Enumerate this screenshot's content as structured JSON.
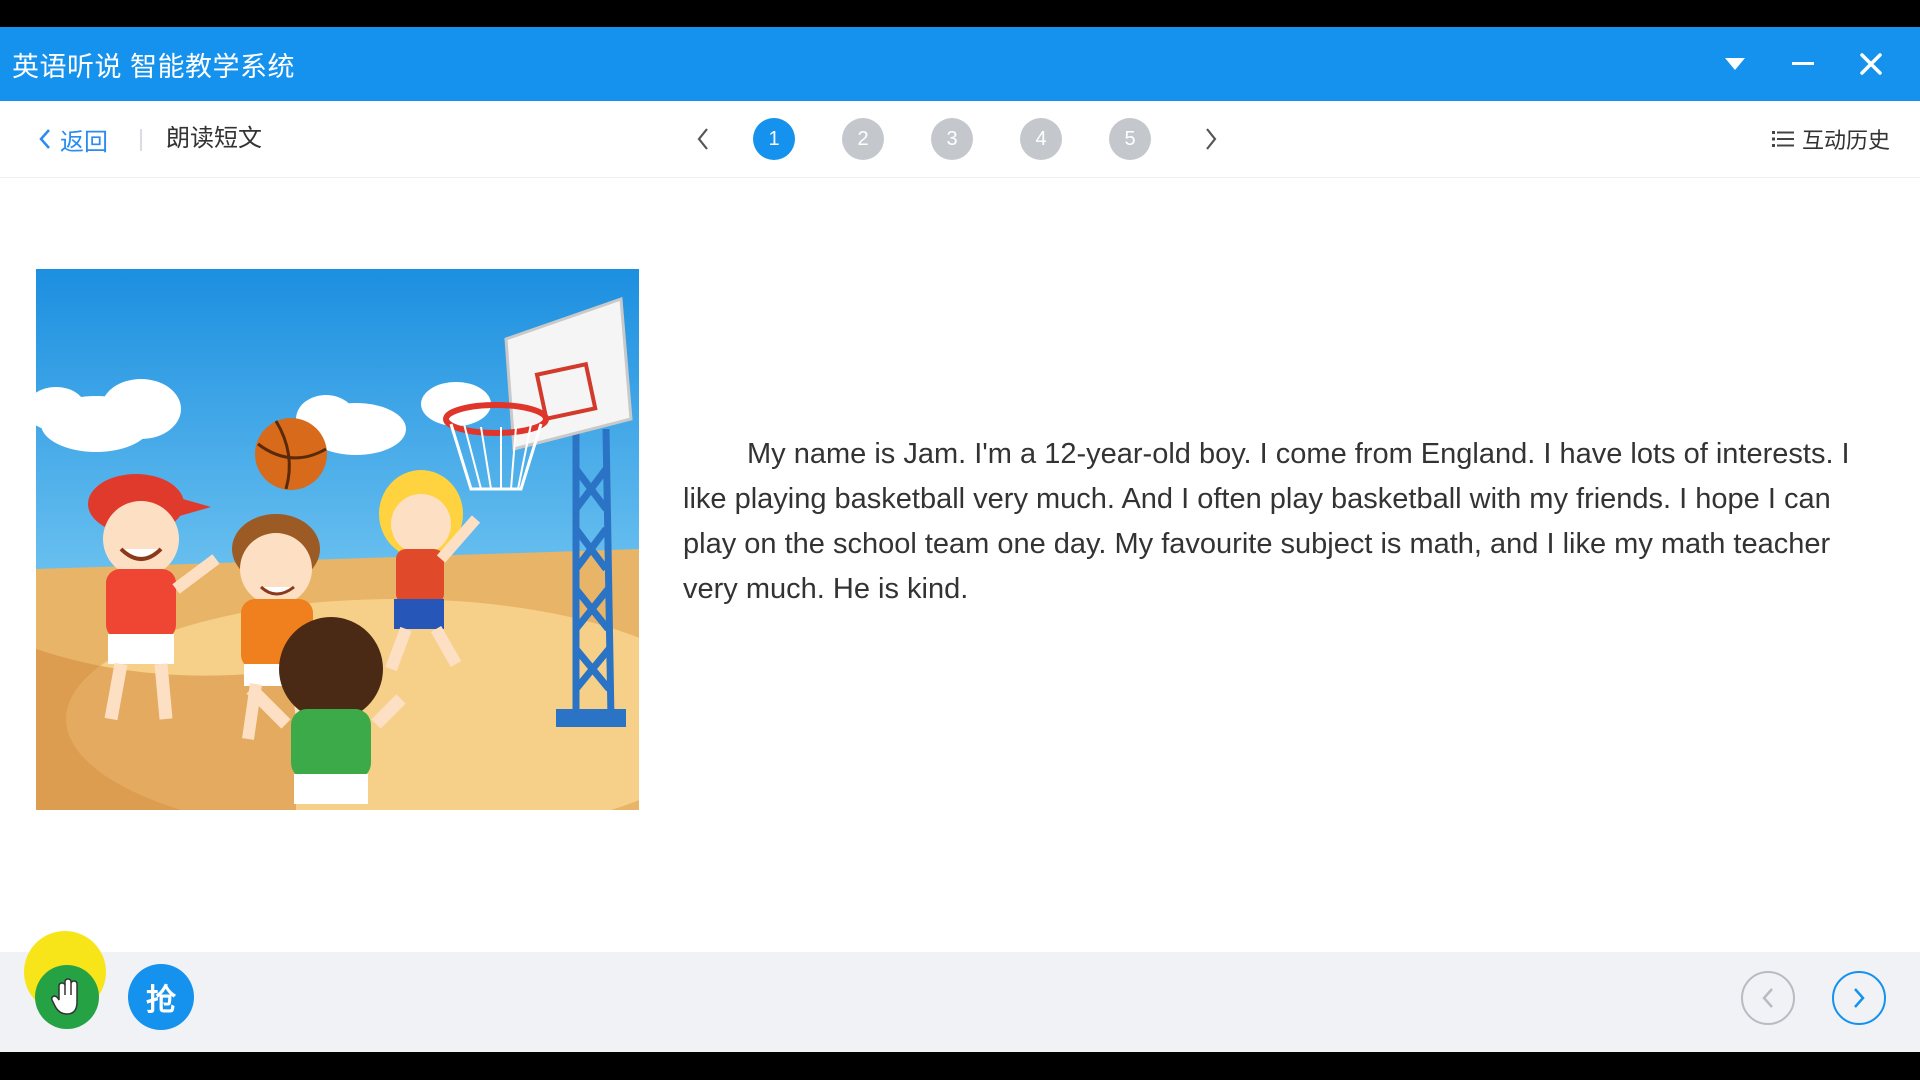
{
  "app": {
    "title": "英语听说 智能教学系统"
  },
  "window_controls": [
    "dropdown-icon",
    "minimize-icon",
    "close-icon"
  ],
  "nav": {
    "back_label": "返回",
    "section_title": "朗读短文",
    "pages": [
      "1",
      "2",
      "3",
      "4",
      "5"
    ],
    "active_page": 1,
    "history_label": "互动历史"
  },
  "content": {
    "picture": "children-playing-basketball-illustration",
    "passage": "My name is Jam. I'm a 12-year-old boy. I come from England. I have lots of interests. I like playing basketball very much. And I often play basketball with my friends. I hope I can play on the school team one day. My favourite subject is math, and I like my math teacher very much. He is kind."
  },
  "bottom": {
    "raise_hand_icon": "hand-icon",
    "grab_label": "抢"
  },
  "colors": {
    "primary": "#1591ee",
    "inactive_page": "#c4c8cd",
    "raise_hand": "#25a244",
    "highlight": "#f7e51a"
  }
}
